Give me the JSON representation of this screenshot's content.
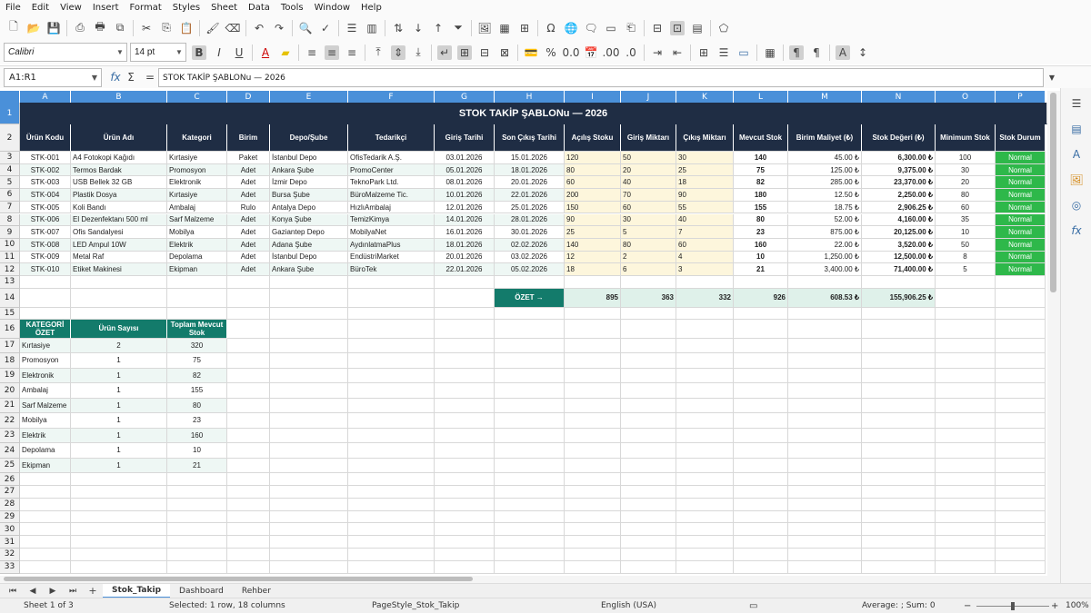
{
  "menu": [
    "File",
    "Edit",
    "View",
    "Insert",
    "Format",
    "Styles",
    "Sheet",
    "Data",
    "Tools",
    "Window",
    "Help"
  ],
  "toolbar": {
    "font_name": "Calibri",
    "font_size": "14 pt"
  },
  "formula": {
    "cell_ref": "A1:R1",
    "content": "STOK TAKİP ŞABLONu — 2026"
  },
  "columns": [
    "A",
    "B",
    "C",
    "D",
    "E",
    "F",
    "G",
    "H",
    "I",
    "J",
    "K",
    "L",
    "M",
    "N",
    "O",
    "P"
  ],
  "rows": [
    "1",
    "2",
    "3",
    "4",
    "5",
    "6",
    "7",
    "8",
    "9",
    "10",
    "11",
    "12",
    "13",
    "14",
    "15",
    "16",
    "17",
    "18",
    "19",
    "20",
    "21",
    "22",
    "23",
    "24",
    "25",
    "26",
    "27",
    "28",
    "29",
    "30",
    "31",
    "32",
    "33"
  ],
  "sheet": {
    "title": "STOK TAKİP ŞABLONu — 2026",
    "headers": [
      "Ürün Kodu",
      "Ürün Adı",
      "Kategori",
      "Birim",
      "Depo/Şube",
      "Tedarikçi",
      "Giriş Tarihi",
      "Son Çıkış Tarihi",
      "Açılış Stoku",
      "Giriş Miktarı",
      "Çıkış Miktarı",
      "Mevcut Stok",
      "Birim Maliyet (₺)",
      "Stok Değeri (₺)",
      "Minimum Stok",
      "Stok Durum"
    ],
    "items": [
      [
        "STK-001",
        "A4 Fotokopi Kağıdı",
        "Kırtasiye",
        "Paket",
        "İstanbul Depo",
        "OfisTedarik A.Ş.",
        "03.01.2026",
        "15.01.2026",
        "120",
        "50",
        "30",
        "140",
        "45.00 ₺",
        "6,300.00 ₺",
        "100",
        "Normal"
      ],
      [
        "STK-002",
        "Termos Bardak",
        "Promosyon",
        "Adet",
        "Ankara Şube",
        "PromoCenter",
        "05.01.2026",
        "18.01.2026",
        "80",
        "20",
        "25",
        "75",
        "125.00 ₺",
        "9,375.00 ₺",
        "30",
        "Normal"
      ],
      [
        "STK-003",
        "USB Bellek 32 GB",
        "Elektronik",
        "Adet",
        "İzmir Depo",
        "TeknoPark Ltd.",
        "08.01.2026",
        "20.01.2026",
        "60",
        "40",
        "18",
        "82",
        "285.00 ₺",
        "23,370.00 ₺",
        "20",
        "Normal"
      ],
      [
        "STK-004",
        "Plastik Dosya",
        "Kırtasiye",
        "Adet",
        "Bursa Şube",
        "BüroMalzeme Tic.",
        "10.01.2026",
        "22.01.2026",
        "200",
        "70",
        "90",
        "180",
        "12.50 ₺",
        "2,250.00 ₺",
        "80",
        "Normal"
      ],
      [
        "STK-005",
        "Koli Bandı",
        "Ambalaj",
        "Rulo",
        "Antalya Depo",
        "HızlıAmbalaj",
        "12.01.2026",
        "25.01.2026",
        "150",
        "60",
        "55",
        "155",
        "18.75 ₺",
        "2,906.25 ₺",
        "60",
        "Normal"
      ],
      [
        "STK-006",
        "El Dezenfektanı 500 ml",
        "Sarf Malzeme",
        "Adet",
        "Konya Şube",
        "TemizKimya",
        "14.01.2026",
        "28.01.2026",
        "90",
        "30",
        "40",
        "80",
        "52.00 ₺",
        "4,160.00 ₺",
        "35",
        "Normal"
      ],
      [
        "STK-007",
        "Ofis Sandalyesi",
        "Mobilya",
        "Adet",
        "Gaziantep Depo",
        "MobilyaNet",
        "16.01.2026",
        "30.01.2026",
        "25",
        "5",
        "7",
        "23",
        "875.00 ₺",
        "20,125.00 ₺",
        "10",
        "Normal"
      ],
      [
        "STK-008",
        "LED Ampul 10W",
        "Elektrik",
        "Adet",
        "Adana Şube",
        "AydınlatmaPlus",
        "18.01.2026",
        "02.02.2026",
        "140",
        "80",
        "60",
        "160",
        "22.00 ₺",
        "3,520.00 ₺",
        "50",
        "Normal"
      ],
      [
        "STK-009",
        "Metal Raf",
        "Depolama",
        "Adet",
        "İstanbul Depo",
        "EndüstriMarket",
        "20.01.2026",
        "03.02.2026",
        "12",
        "2",
        "4",
        "10",
        "1,250.00 ₺",
        "12,500.00 ₺",
        "8",
        "Normal"
      ],
      [
        "STK-010",
        "Etiket Makinesi",
        "Ekipman",
        "Adet",
        "Ankara Şube",
        "BüroTek",
        "22.01.2026",
        "05.02.2026",
        "18",
        "6",
        "3",
        "21",
        "3,400.00 ₺",
        "71,400.00 ₺",
        "5",
        "Normal"
      ]
    ],
    "summary": {
      "label": "ÖZET →",
      "values": [
        "895",
        "363",
        "332",
        "926",
        "608.53 ₺",
        "155,906.25 ₺"
      ]
    },
    "cat_headers": [
      "KATEGORİ ÖZET",
      "Ürün Sayısı",
      "Toplam Mevcut Stok"
    ],
    "cat_rows": [
      [
        "Kırtasiye",
        "2",
        "320"
      ],
      [
        "Promosyon",
        "1",
        "75"
      ],
      [
        "Elektronik",
        "1",
        "82"
      ],
      [
        "Ambalaj",
        "1",
        "155"
      ],
      [
        "Sarf Malzeme",
        "1",
        "80"
      ],
      [
        "Mobilya",
        "1",
        "23"
      ],
      [
        "Elektrik",
        "1",
        "160"
      ],
      [
        "Depolama",
        "1",
        "10"
      ],
      [
        "Ekipman",
        "1",
        "21"
      ]
    ]
  },
  "tabs": [
    "Stok_Takip",
    "Dashboard",
    "Rehber"
  ],
  "status": {
    "sheet": "Sheet 1 of 3",
    "selected": "Selected: 1 row, 18 columns",
    "pagestyle": "PageStyle_Stok_Takip",
    "lang": "English (USA)",
    "sum": "Average: ; Sum: 0",
    "zoom": "100%"
  },
  "colors": {
    "header_bg": "#1f2d44",
    "col_header": "#4a90d9",
    "summary_teal": "#137b6b",
    "status_green": "#2eb84a"
  }
}
